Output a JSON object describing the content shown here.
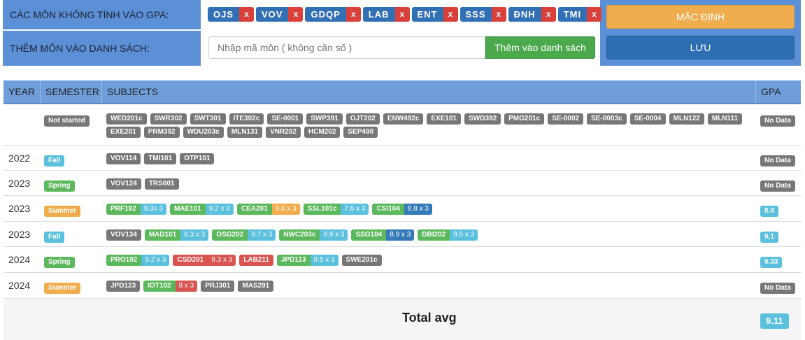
{
  "settings": {
    "excluded_label": "CÁC MÔN KHÔNG TÍNH VÀO GPA:",
    "add_label": "THÊM MÔN VÀO DANH SÁCH:",
    "excluded_subjects": [
      "OJS",
      "VOV",
      "GDQP",
      "LAB",
      "ENT",
      "SSS",
      "ĐNH",
      "TMI"
    ],
    "remove_symbol": "x",
    "input_placeholder": "Nhập mã môn ( không cần số )",
    "add_button": "Thêm vào danh sách",
    "default_button": "MẶC ĐỊNH",
    "save_button": "LƯU"
  },
  "table": {
    "headers": {
      "year": "YEAR",
      "semester": "SEMESTER",
      "subjects": "SUBJECTS",
      "gpa": "GPA"
    },
    "rows": [
      {
        "year": "",
        "semester": "Not started",
        "sem_color": "gray",
        "gpa": "No Data",
        "gpa_color": "gray",
        "subjects": [
          {
            "code": "WED201c",
            "color": "gray"
          },
          {
            "code": "SWR302",
            "color": "gray"
          },
          {
            "code": "SWT301",
            "color": "gray"
          },
          {
            "code": "ITE302c",
            "color": "gray"
          },
          {
            "code": "SE-0001",
            "color": "gray"
          },
          {
            "code": "SWP391",
            "color": "gray"
          },
          {
            "code": "OJT202",
            "color": "gray"
          },
          {
            "code": "ENW492c",
            "color": "gray"
          },
          {
            "code": "EXE101",
            "color": "gray"
          },
          {
            "code": "SWD392",
            "color": "gray"
          },
          {
            "code": "PMG201c",
            "color": "gray"
          },
          {
            "code": "SE-0002",
            "color": "gray"
          },
          {
            "code": "SE-0003c",
            "color": "gray"
          },
          {
            "code": "SE-0004",
            "color": "gray"
          },
          {
            "code": "MLN122",
            "color": "gray"
          },
          {
            "code": "MLN111",
            "color": "gray"
          },
          {
            "code": "EXE201",
            "color": "gray"
          },
          {
            "code": "PRM392",
            "color": "gray"
          },
          {
            "code": "WDU203c",
            "color": "gray"
          },
          {
            "code": "MLN131",
            "color": "gray"
          },
          {
            "code": "VNR202",
            "color": "gray"
          },
          {
            "code": "HCM202",
            "color": "gray"
          },
          {
            "code": "SEP490",
            "color": "gray"
          }
        ]
      },
      {
        "year": "2022",
        "semester": "Fall",
        "sem_color": "blue",
        "gpa": "No Data",
        "gpa_color": "gray",
        "subjects": [
          {
            "code": "VOV114",
            "color": "gray"
          },
          {
            "code": "TMI101",
            "color": "gray"
          },
          {
            "code": "OTP101",
            "color": "gray"
          }
        ]
      },
      {
        "year": "2023",
        "semester": "Spring",
        "sem_color": "green",
        "gpa": "No Data",
        "gpa_color": "gray",
        "subjects": [
          {
            "code": "VOV124",
            "color": "gray"
          },
          {
            "code": "TRS601",
            "color": "gray"
          }
        ]
      },
      {
        "year": "2023",
        "semester": "Summer",
        "sem_color": "orange",
        "gpa": "8.9",
        "gpa_color": "blue",
        "subjects": [
          {
            "code": "PRF192",
            "color": "green",
            "grade": "9.3x 3",
            "grade_color": "blue"
          },
          {
            "code": "MAE101",
            "color": "green",
            "grade": "9.2 x 3",
            "grade_color": "blue"
          },
          {
            "code": "CEA201",
            "color": "green",
            "grade": "9.6 x 3",
            "grade_color": "orange"
          },
          {
            "code": "SSL101c",
            "color": "green",
            "grade": "7.6 x 3",
            "grade_color": "blue"
          },
          {
            "code": "CSI104",
            "color": "green",
            "grade": "8.8 x 3",
            "grade_color": "navy"
          }
        ]
      },
      {
        "year": "2023",
        "semester": "Fall",
        "sem_color": "blue",
        "gpa": "9,1",
        "gpa_color": "blue",
        "subjects": [
          {
            "code": "VOV134",
            "color": "gray"
          },
          {
            "code": "MAD101",
            "color": "green",
            "grade": "8.3 x 3",
            "grade_color": "blue"
          },
          {
            "code": "OSG202",
            "color": "green",
            "grade": "9.7 x 3",
            "grade_color": "blue"
          },
          {
            "code": "NWC203c",
            "color": "green",
            "grade": "8.9 x 3",
            "grade_color": "blue"
          },
          {
            "code": "SSG104",
            "color": "green",
            "grade": "8.9 x 3",
            "grade_color": "navy"
          },
          {
            "code": "DBI202",
            "color": "green",
            "grade": "9.5 x 3",
            "grade_color": "blue"
          }
        ]
      },
      {
        "year": "2024",
        "semester": "Spring",
        "sem_color": "green",
        "gpa": "9.33",
        "gpa_color": "blue",
        "subjects": [
          {
            "code": "PRO192",
            "color": "green",
            "grade": "9.2 x 3",
            "grade_color": "blue"
          },
          {
            "code": "CSD201",
            "color": "red",
            "grade": "9.3 x 3",
            "grade_color": "red"
          },
          {
            "code": "LAB211",
            "color": "red"
          },
          {
            "code": "JPD113",
            "color": "green",
            "grade": "9.5 x 3",
            "grade_color": "blue"
          },
          {
            "code": "SWE201c",
            "color": "gray"
          }
        ]
      },
      {
        "year": "2024",
        "semester": "Summer",
        "sem_color": "orange",
        "gpa": "No Data",
        "gpa_color": "gray",
        "subjects": [
          {
            "code": "JPD123",
            "color": "gray"
          },
          {
            "code": "IOT102",
            "color": "green",
            "grade": "8 x 3",
            "grade_color": "red"
          },
          {
            "code": "PRJ301",
            "color": "gray"
          },
          {
            "code": "MAS291",
            "color": "gray"
          }
        ]
      }
    ]
  },
  "total": {
    "label": "Total avg",
    "value": "9.11"
  }
}
